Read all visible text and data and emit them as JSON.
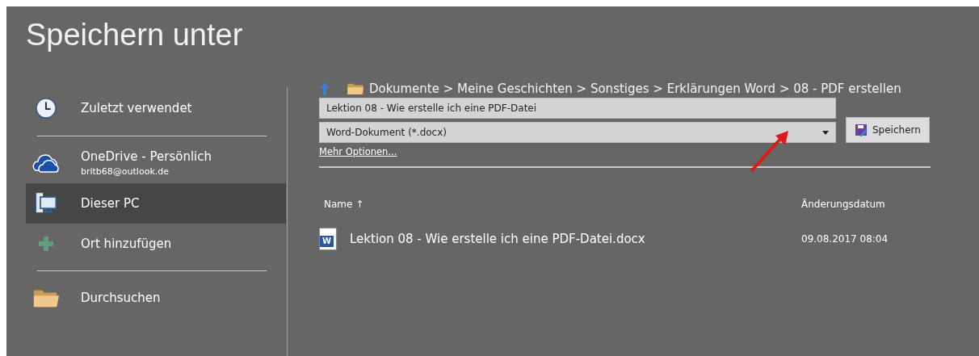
{
  "title": "Speichern unter",
  "places": [
    {
      "kind": "recent",
      "label": "Zuletzt verwendet",
      "selected": false
    },
    {
      "kind": "onedrive",
      "label": "OneDrive - Persönlich",
      "sublabel": "britb68@outlook.de",
      "selected": false
    },
    {
      "kind": "pc",
      "label": "Dieser PC",
      "selected": true
    },
    {
      "kind": "add",
      "label": "Ort hinzufügen",
      "selected": false
    },
    {
      "kind": "browse",
      "label": "Durchsuchen",
      "selected": false
    }
  ],
  "breadcrumb": "Dokumente > Meine Geschichten > Sonstiges > Erklärungen Word > 08 - PDF erstellen",
  "filename": "Lektion 08 - Wie erstelle ich eine PDF-Datei",
  "filetype": "Word-Dokument (*.docx)",
  "save_button": "Speichern",
  "more_options": "Mehr Optionen...",
  "columns": [
    {
      "label": "Name",
      "sort": "↑"
    },
    {
      "label": "Änderungsdatum"
    }
  ],
  "files": [
    {
      "icon_letter": "W",
      "name": "Lektion 08 - Wie erstelle ich eine PDF-Datei.docx",
      "date": "09.08.2017 08:04"
    }
  ]
}
